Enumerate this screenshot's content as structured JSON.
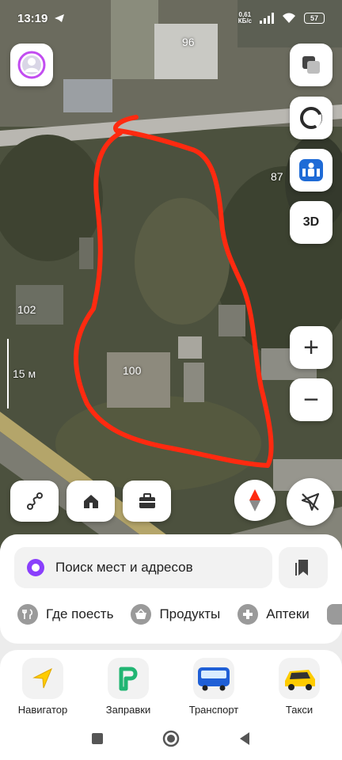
{
  "status_bar": {
    "time": "13:19",
    "net_speed_value": "0,61",
    "net_speed_unit": "КБ/с",
    "battery": "57"
  },
  "map": {
    "house_labels": [
      "96",
      "87",
      "102",
      "100"
    ],
    "scale_label": "15 м",
    "drawing_color": "#ff2a10"
  },
  "map_controls": {
    "three_d_label": "3D",
    "zoom_in_label": "+",
    "zoom_out_label": "−"
  },
  "search": {
    "placeholder": "Поиск мест и адресов"
  },
  "quick_chips": [
    {
      "label": "Где поесть",
      "icon": "fork-knife-icon"
    },
    {
      "label": "Продукты",
      "icon": "basket-icon"
    },
    {
      "label": "Аптеки",
      "icon": "plus-cross-icon"
    }
  ],
  "services": [
    {
      "label": "Навигатор",
      "icon": "navigator-arrow-icon"
    },
    {
      "label": "Заправки",
      "icon": "fuel-icon"
    },
    {
      "label": "Транспорт",
      "icon": "bus-icon"
    },
    {
      "label": "Такси",
      "icon": "taxi-icon"
    }
  ],
  "colors": {
    "accent_red": "#ff2a10",
    "alice_purple": "#8a3ffc",
    "navigator_yellow": "#ffcc00",
    "fuel_green": "#21b573",
    "bus_blue": "#1f5fd6"
  }
}
